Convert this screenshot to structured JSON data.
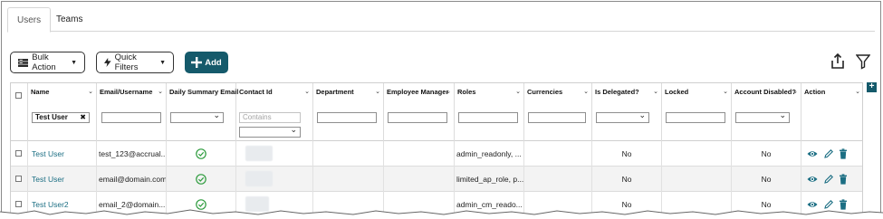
{
  "tabs": [
    {
      "label": "Users",
      "active": true
    },
    {
      "label": "Teams",
      "active": false
    }
  ],
  "toolbar": {
    "bulk_action_label": "Bulk Action",
    "quick_filters_label": "Quick Filters",
    "add_label": "Add",
    "accent_color": "#155a6b"
  },
  "columns": {
    "name": "Name",
    "email": "Email/Username",
    "daily": "Daily Summary Email",
    "contact": "Contact Id",
    "department": "Department",
    "manager": "Employee Manager",
    "roles": "Roles",
    "currencies": "Currencies",
    "delegated": "Is Delegated?",
    "locked": "Locked",
    "disabled": "Account Disabled?",
    "action": "Action"
  },
  "filters": {
    "name_value": "Test User",
    "contact_placeholder": "Contains"
  },
  "rows": [
    {
      "name": "Test User",
      "email": "test_123@accrual...",
      "roles": "admin_readonly, ...",
      "delegated": "No",
      "disabled": "No"
    },
    {
      "name": "Test User",
      "email": "email@domain.com",
      "roles": "limited_ap_role, p...",
      "delegated": "No",
      "disabled": "No"
    },
    {
      "name": "Test User2",
      "email": "email_2@domain....",
      "roles": "admin_cm_reado...",
      "delegated": "No",
      "disabled": "No"
    }
  ]
}
